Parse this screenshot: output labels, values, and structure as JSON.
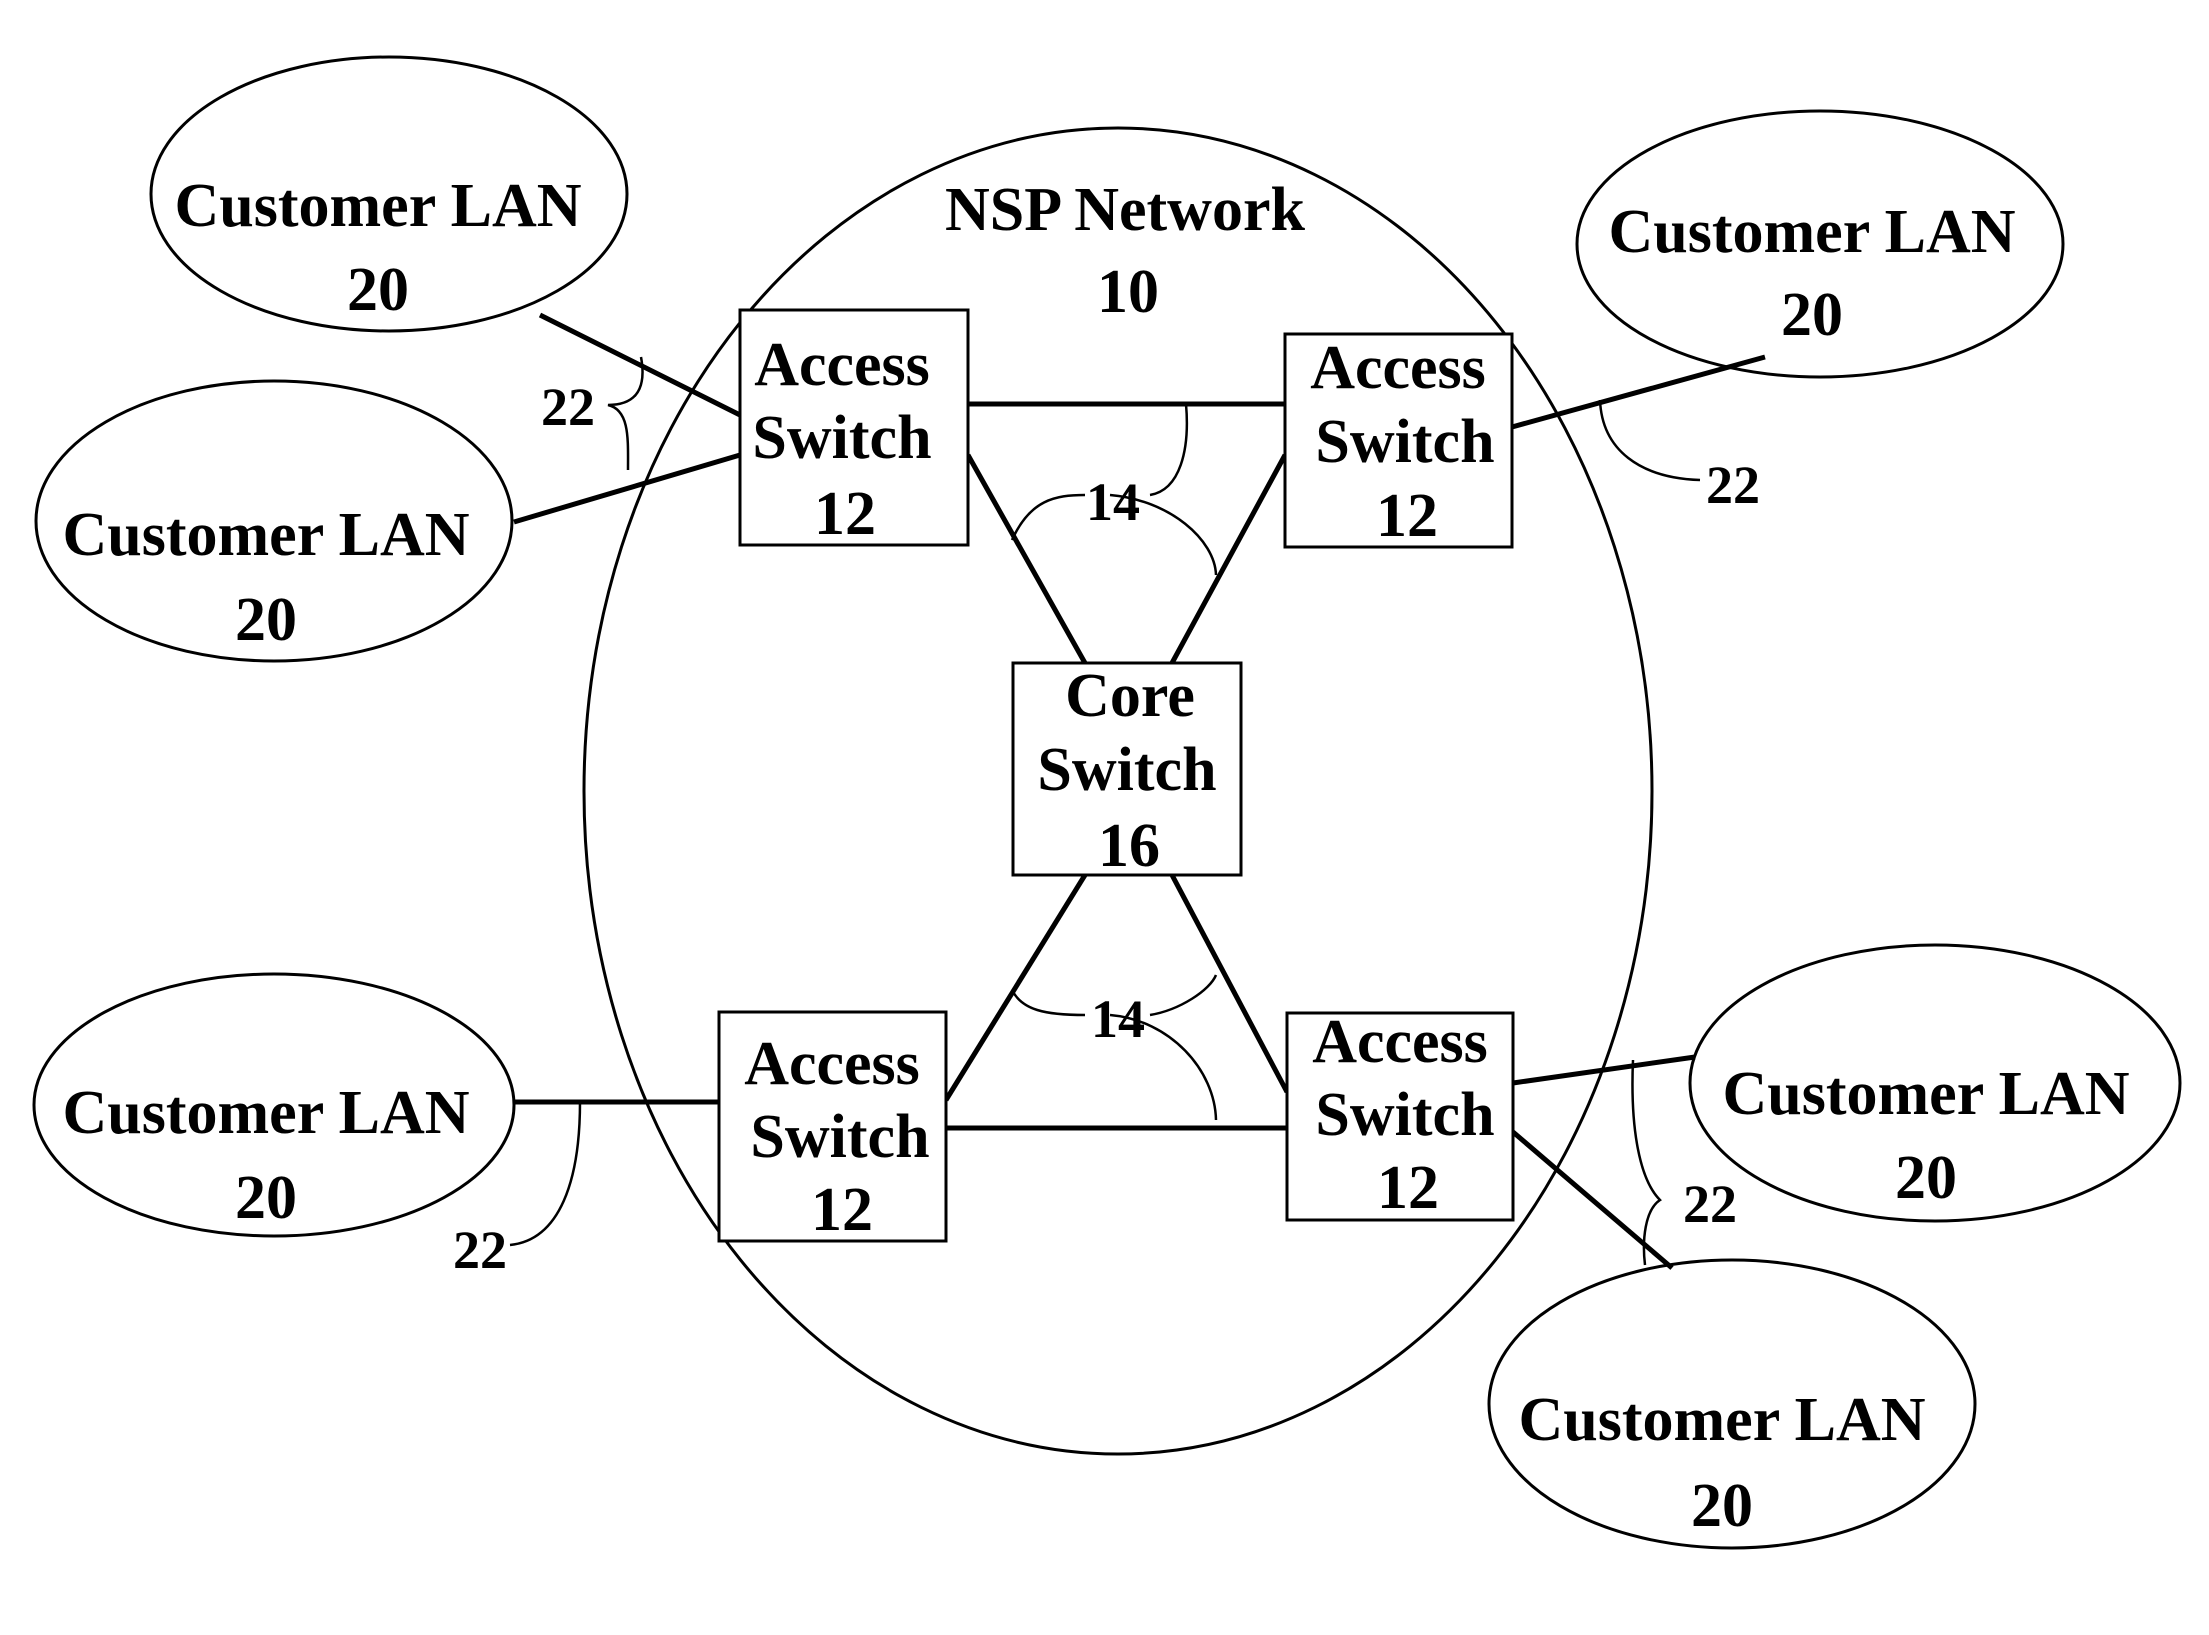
{
  "network": {
    "title": "NSP Network",
    "ref": "10"
  },
  "access_switches": [
    {
      "line1": "Access",
      "line2": "Switch",
      "ref": "12"
    },
    {
      "line1": "Access",
      "line2": "Switch",
      "ref": "12"
    },
    {
      "line1": "Access",
      "line2": "Switch",
      "ref": "12"
    },
    {
      "line1": "Access",
      "line2": "Switch",
      "ref": "12"
    }
  ],
  "core_switch": {
    "line1": "Core",
    "line2": "Switch",
    "ref": "16"
  },
  "customer_lans": [
    {
      "label": "Customer LAN",
      "ref": "20"
    },
    {
      "label": "Customer LAN",
      "ref": "20"
    },
    {
      "label": "Customer LAN",
      "ref": "20"
    },
    {
      "label": "Customer LAN",
      "ref": "20"
    },
    {
      "label": "Customer LAN",
      "ref": "20"
    },
    {
      "label": "Customer LAN",
      "ref": "20"
    }
  ],
  "ref_labels": {
    "trunk_links": "14",
    "customer_links": "22"
  }
}
